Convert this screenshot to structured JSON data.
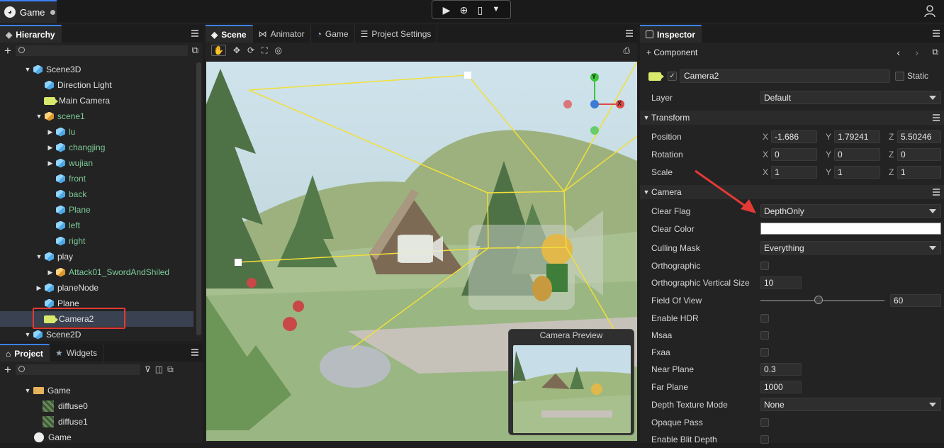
{
  "app": {
    "doc_tab": "Game"
  },
  "hierarchy": {
    "tab": "Hierarchy",
    "items": [
      {
        "label": "Scene3D",
        "depth": 0,
        "arrow": "down",
        "icon": "cube-blue",
        "prefab": false
      },
      {
        "label": "Direction Light",
        "depth": 1,
        "arrow": "",
        "icon": "cube-blue",
        "prefab": false
      },
      {
        "label": "Main Camera",
        "depth": 1,
        "arrow": "",
        "icon": "camera",
        "prefab": false
      },
      {
        "label": "scene1",
        "depth": 1,
        "arrow": "down",
        "icon": "cube-orange",
        "prefab": true
      },
      {
        "label": "lu",
        "depth": 2,
        "arrow": "right",
        "icon": "cube-blue",
        "prefab": true
      },
      {
        "label": "changjing",
        "depth": 2,
        "arrow": "right",
        "icon": "cube-blue",
        "prefab": true
      },
      {
        "label": "wujian",
        "depth": 2,
        "arrow": "right",
        "icon": "cube-blue",
        "prefab": true
      },
      {
        "label": "front",
        "depth": 2,
        "arrow": "",
        "icon": "cube-blue",
        "prefab": true
      },
      {
        "label": "back",
        "depth": 2,
        "arrow": "",
        "icon": "cube-blue",
        "prefab": true
      },
      {
        "label": "Plane",
        "depth": 2,
        "arrow": "",
        "icon": "cube-blue",
        "prefab": true
      },
      {
        "label": "left",
        "depth": 2,
        "arrow": "",
        "icon": "cube-blue",
        "prefab": true
      },
      {
        "label": "right",
        "depth": 2,
        "arrow": "",
        "icon": "cube-blue",
        "prefab": true
      },
      {
        "label": "play",
        "depth": 1,
        "arrow": "down",
        "icon": "cube-blue",
        "prefab": false
      },
      {
        "label": "Attack01_SwordAndShiled",
        "depth": 2,
        "arrow": "right",
        "icon": "cube-orange",
        "prefab": true
      },
      {
        "label": "planeNode",
        "depth": 1,
        "arrow": "right",
        "icon": "cube-blue",
        "prefab": false
      },
      {
        "label": "Plane",
        "depth": 1,
        "arrow": "",
        "icon": "cube-blue",
        "prefab": false
      },
      {
        "label": "Camera2",
        "depth": 1,
        "arrow": "",
        "icon": "camera",
        "prefab": false,
        "selected": true
      },
      {
        "label": "Scene2D",
        "depth": 0,
        "arrow": "down",
        "icon": "cube-blue",
        "prefab": false
      }
    ]
  },
  "project": {
    "tabs": [
      "Project",
      "Widgets"
    ],
    "items": [
      {
        "label": "Game",
        "depth": 0,
        "icon": "folder"
      },
      {
        "label": "diffuse0",
        "depth": 1,
        "icon": "texture"
      },
      {
        "label": "diffuse1",
        "depth": 1,
        "icon": "texture"
      },
      {
        "label": "Game",
        "depth": -1,
        "icon": "logo"
      }
    ]
  },
  "scene": {
    "tabs": [
      "Scene",
      "Animator",
      "Game",
      "Project Settings"
    ],
    "preview_title": "Camera Preview",
    "gizmo_y": "Y",
    "gizmo_x": "X"
  },
  "inspector": {
    "tab": "Inspector",
    "add_component": "+ Component",
    "object_name": "Camera2",
    "static_label": "Static",
    "layer": {
      "label": "Layer",
      "value": "Default"
    },
    "transform": {
      "title": "Transform",
      "position": {
        "label": "Position",
        "x": "-1.686",
        "y": "1.79241",
        "z": "5.50246"
      },
      "rotation": {
        "label": "Rotation",
        "x": "0",
        "y": "0",
        "z": "0"
      },
      "scale": {
        "label": "Scale",
        "x": "1",
        "y": "1",
        "z": "1"
      }
    },
    "camera": {
      "title": "Camera",
      "clear_flag": {
        "label": "Clear Flag",
        "value": "DepthOnly"
      },
      "clear_color": {
        "label": "Clear Color",
        "value": "#ffffff"
      },
      "culling_mask": {
        "label": "Culling Mask",
        "value": "Everything"
      },
      "orthographic": {
        "label": "Orthographic"
      },
      "ortho_size": {
        "label": "Orthographic Vertical Size",
        "value": "10"
      },
      "fov": {
        "label": "Field Of View",
        "value": "60",
        "fraction": 0.47
      },
      "hdr": {
        "label": "Enable HDR"
      },
      "msaa": {
        "label": "Msaa"
      },
      "fxaa": {
        "label": "Fxaa"
      },
      "near": {
        "label": "Near Plane",
        "value": "0.3"
      },
      "far": {
        "label": "Far Plane",
        "value": "1000"
      },
      "depth_mode": {
        "label": "Depth Texture Mode",
        "value": "None"
      },
      "opaque_pass": {
        "label": "Opaque Pass"
      },
      "blit_depth": {
        "label": "Enable Blit Depth"
      }
    }
  },
  "axes": {
    "x": "X",
    "y": "Y",
    "z": "Z"
  },
  "colors": {
    "accent": "#3b82f6",
    "selection": "#3a4150",
    "highlight": "#e53935",
    "prefab_text": "#7ecb9a"
  }
}
